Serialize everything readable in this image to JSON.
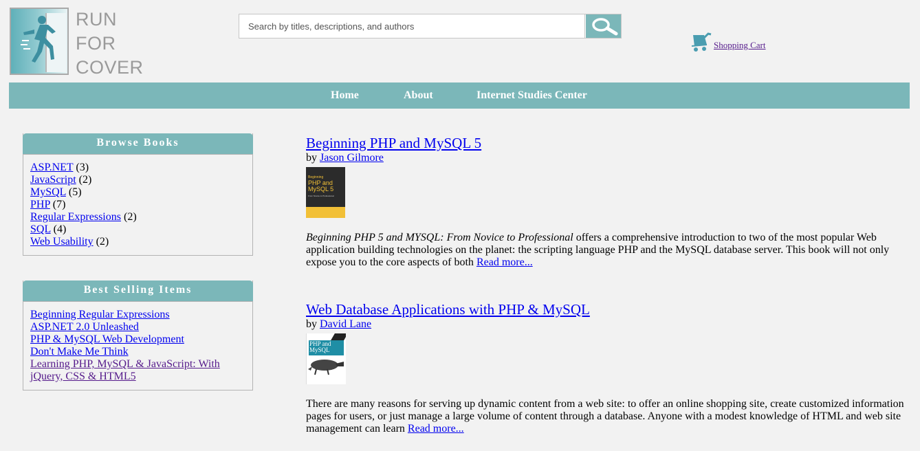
{
  "logo": {
    "lines": [
      "RUN",
      "FOR",
      "COVER"
    ]
  },
  "search": {
    "placeholder": "Search by titles, descriptions, and authors",
    "button_icon": "magnifier-icon"
  },
  "cart": {
    "label": " Shopping Cart",
    "icon": "cart-icon"
  },
  "nav": {
    "items": [
      "Home",
      "About",
      "Internet Studies Center"
    ]
  },
  "colors": {
    "accent": "#7bb7b9",
    "background": "#f2f2f2",
    "link": "#0000ee",
    "visited": "#551a8b"
  },
  "browse": {
    "title": "Browse Books",
    "items": [
      {
        "label": "ASP.NET",
        "count": "(3)"
      },
      {
        "label": "JavaScript",
        "count": "(2)"
      },
      {
        "label": "MySQL",
        "count": "(5)"
      },
      {
        "label": "PHP",
        "count": "(7)"
      },
      {
        "label": "Regular Expressions",
        "count": "(2)"
      },
      {
        "label": "SQL",
        "count": "(4)"
      },
      {
        "label": "Web Usability",
        "count": "(2)"
      }
    ]
  },
  "bestsellers": {
    "title": "Best Selling Items",
    "items": [
      "Beginning Regular Expressions",
      "ASP.NET 2.0 Unleashed",
      "PHP & MySQL Web Development",
      "Don't Make Me Think",
      "Learning PHP, MySQL & JavaScript: With jQuery, CSS & HTML5"
    ]
  },
  "books": [
    {
      "title": "Beginning PHP and MySQL 5",
      "by": "by ",
      "author": "Jason Gilmore",
      "cover": {
        "top_text": "Beginning",
        "main": "PHP and MySQL 5",
        "sub": "From Novice to Professional"
      },
      "desc_italic": "Beginning PHP 5 and MYSQL: From Novice to Professional",
      "desc": " offers a comprehensive introduction to two of the most popular Web application building technologies on the planet: the scripting language PHP and the MySQL database server. This book will not only expose you to the core aspects of both ",
      "read_more": "Read more..."
    },
    {
      "title": "Web Database Applications with PHP & MySQL",
      "by": "by ",
      "author": "David Lane",
      "cover": {
        "main": "PHP and MySQL"
      },
      "desc_italic": "",
      "desc": "There are many reasons for serving up dynamic content from a web site: to offer an online shopping site, create customized information pages for users, or just manage a large volume of content through a database. Anyone with a modest knowledge of HTML and web site management can learn ",
      "read_more": "Read more..."
    }
  ]
}
